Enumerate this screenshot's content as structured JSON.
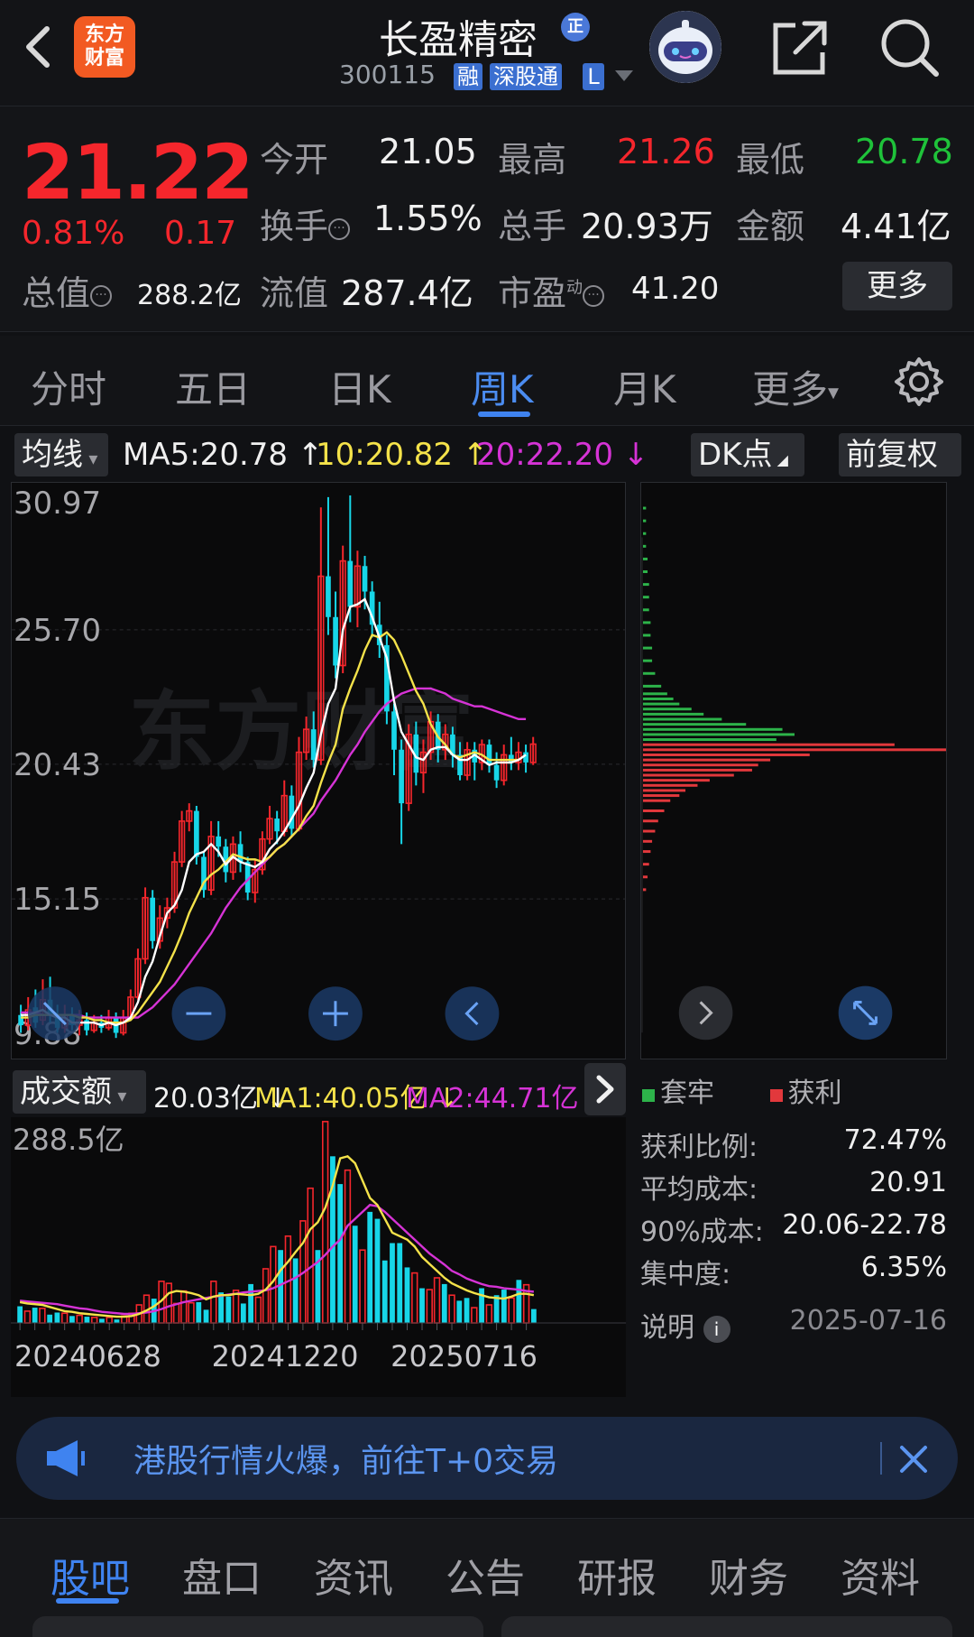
{
  "header": {
    "title": "长盈精密",
    "badge": "正",
    "logo_line1": "东方",
    "logo_line2": "财富",
    "code": "300115",
    "tags": [
      "融",
      "深股通",
      "L"
    ]
  },
  "quote": {
    "price": "21.22",
    "pct_change": "0.81%",
    "change": "0.17",
    "rows": [
      [
        {
          "label": "今开",
          "value": "21.05",
          "color": "white"
        },
        {
          "label": "最高",
          "value": "21.26",
          "color": "red"
        },
        {
          "label": "最低",
          "value": "20.78",
          "color": "green"
        }
      ],
      [
        {
          "label": "换手",
          "value": "1.55%",
          "color": "white"
        },
        {
          "label": "总手",
          "value": "20.93万",
          "color": "white"
        },
        {
          "label": "金额",
          "value": "4.41亿",
          "color": "white"
        }
      ],
      [
        {
          "label": "总值",
          "value": "288.2亿",
          "color": "white"
        },
        {
          "label": "流值",
          "value": "287.4亿",
          "color": "white"
        },
        {
          "label": "市盈",
          "label_sup": "动",
          "value": "41.20",
          "color": "white"
        }
      ]
    ],
    "more_label": "更多"
  },
  "tabs": [
    {
      "label": "分时",
      "active": false
    },
    {
      "label": "五日",
      "active": false
    },
    {
      "label": "日K",
      "active": false
    },
    {
      "label": "周K",
      "active": true
    },
    {
      "label": "月K",
      "active": false
    },
    {
      "label": "更多",
      "active": false
    }
  ],
  "ma_legend": {
    "selector": "均线",
    "ma5": "MA5:20.78 ↑",
    "ma10": "10:20.82 ↑",
    "ma20": "20:22.20 ↓",
    "dk": "DK点",
    "adjust": "前复权"
  },
  "volume_legend": {
    "selector": "成交额",
    "value": "20.03亿 ↓",
    "ma1": "MA1:40.05亿 ↓",
    "ma2": "MA2:44.71亿 ↓"
  },
  "chip_distribution": {
    "legend_trapped": "套牢",
    "legend_profit": "获利",
    "rows": [
      {
        "label": "获利比例:",
        "value": "72.47%"
      },
      {
        "label": "平均成本:",
        "value": "20.91"
      },
      {
        "label": "90%成本:",
        "value": "20.06-22.78"
      },
      {
        "label": "集中度:",
        "value": "6.35%"
      }
    ],
    "explain_label": "说明",
    "date": "2025-07-16"
  },
  "banner": {
    "text": "港股行情火爆，前往T+0交易"
  },
  "bottom_tabs": [
    {
      "label": "股吧",
      "active": true
    },
    {
      "label": "盘口",
      "active": false
    },
    {
      "label": "资讯",
      "active": false
    },
    {
      "label": "公告",
      "active": false
    },
    {
      "label": "研报",
      "active": false
    },
    {
      "label": "财务",
      "active": false
    },
    {
      "label": "资料",
      "active": false
    }
  ],
  "watermark": "东方财富",
  "chart_data": {
    "type": "candlestick",
    "title": "",
    "y_ticks": [
      "30.97",
      "25.70",
      "20.43",
      "15.15",
      "9.88"
    ],
    "ylim": [
      9.88,
      30.97
    ],
    "x_ticks": [
      "20240628",
      "20241220",
      "20250716"
    ],
    "volume_ylabel": "288.5亿",
    "candles": [
      {
        "o": 10.6,
        "c": 10.2,
        "h": 11.0,
        "l": 9.9
      },
      {
        "o": 10.2,
        "c": 10.8,
        "h": 11.3,
        "l": 10.0
      },
      {
        "o": 10.9,
        "c": 10.3,
        "h": 11.6,
        "l": 10.1
      },
      {
        "o": 10.4,
        "c": 11.2,
        "h": 12.0,
        "l": 10.2
      },
      {
        "o": 11.2,
        "c": 10.6,
        "h": 12.1,
        "l": 10.3
      },
      {
        "o": 10.6,
        "c": 10.1,
        "h": 11.0,
        "l": 9.9
      },
      {
        "o": 10.1,
        "c": 10.6,
        "h": 11.0,
        "l": 9.9
      },
      {
        "o": 10.6,
        "c": 10.2,
        "h": 10.9,
        "l": 10.0
      },
      {
        "o": 10.2,
        "c": 10.4,
        "h": 10.8,
        "l": 9.8
      },
      {
        "o": 10.4,
        "c": 10.0,
        "h": 10.7,
        "l": 9.8
      },
      {
        "o": 10.0,
        "c": 10.3,
        "h": 10.6,
        "l": 9.9
      },
      {
        "o": 10.3,
        "c": 10.1,
        "h": 10.6,
        "l": 9.9
      },
      {
        "o": 10.1,
        "c": 10.5,
        "h": 10.8,
        "l": 10.0
      },
      {
        "o": 10.5,
        "c": 9.9,
        "h": 10.7,
        "l": 9.7
      },
      {
        "o": 9.9,
        "c": 10.5,
        "h": 10.8,
        "l": 9.8
      },
      {
        "o": 10.5,
        "c": 11.3,
        "h": 11.6,
        "l": 10.4
      },
      {
        "o": 11.3,
        "c": 12.8,
        "h": 13.2,
        "l": 11.2
      },
      {
        "o": 12.8,
        "c": 15.2,
        "h": 15.6,
        "l": 12.6
      },
      {
        "o": 15.2,
        "c": 13.5,
        "h": 15.5,
        "l": 13.2
      },
      {
        "o": 13.5,
        "c": 14.4,
        "h": 14.9,
        "l": 13.2
      },
      {
        "o": 14.4,
        "c": 14.8,
        "h": 15.2,
        "l": 14.0
      },
      {
        "o": 14.8,
        "c": 16.6,
        "h": 17.0,
        "l": 14.6
      },
      {
        "o": 16.6,
        "c": 18.2,
        "h": 18.6,
        "l": 16.4
      },
      {
        "o": 18.2,
        "c": 18.6,
        "h": 18.9,
        "l": 17.8
      },
      {
        "o": 18.6,
        "c": 16.8,
        "h": 18.8,
        "l": 16.5
      },
      {
        "o": 16.8,
        "c": 15.5,
        "h": 17.0,
        "l": 15.2
      },
      {
        "o": 15.5,
        "c": 17.6,
        "h": 18.2,
        "l": 15.3
      },
      {
        "o": 17.6,
        "c": 17.2,
        "h": 18.2,
        "l": 16.8
      },
      {
        "o": 17.2,
        "c": 16.2,
        "h": 17.5,
        "l": 15.8
      },
      {
        "o": 16.2,
        "c": 17.3,
        "h": 17.6,
        "l": 15.9
      },
      {
        "o": 17.3,
        "c": 16.6,
        "h": 17.8,
        "l": 16.2
      },
      {
        "o": 16.6,
        "c": 15.4,
        "h": 16.8,
        "l": 15.1
      },
      {
        "o": 15.4,
        "c": 16.3,
        "h": 16.7,
        "l": 15.0
      },
      {
        "o": 16.3,
        "c": 17.5,
        "h": 17.8,
        "l": 16.1
      },
      {
        "o": 17.5,
        "c": 18.3,
        "h": 18.8,
        "l": 17.3
      },
      {
        "o": 18.3,
        "c": 17.8,
        "h": 18.6,
        "l": 17.3
      },
      {
        "o": 17.8,
        "c": 19.2,
        "h": 19.8,
        "l": 17.6
      },
      {
        "o": 19.2,
        "c": 17.9,
        "h": 19.6,
        "l": 17.6
      },
      {
        "o": 17.9,
        "c": 20.9,
        "h": 21.5,
        "l": 17.8
      },
      {
        "o": 20.9,
        "c": 21.8,
        "h": 22.3,
        "l": 20.6
      },
      {
        "o": 21.8,
        "c": 20.6,
        "h": 22.5,
        "l": 20.3
      },
      {
        "o": 20.6,
        "c": 27.8,
        "h": 30.5,
        "l": 20.4
      },
      {
        "o": 27.8,
        "c": 26.2,
        "h": 30.9,
        "l": 25.5
      },
      {
        "o": 26.2,
        "c": 24.3,
        "h": 27.2,
        "l": 23.8
      },
      {
        "o": 24.3,
        "c": 28.4,
        "h": 29.0,
        "l": 24.0
      },
      {
        "o": 28.4,
        "c": 26.6,
        "h": 30.97,
        "l": 26.0
      },
      {
        "o": 26.6,
        "c": 28.2,
        "h": 28.8,
        "l": 25.8
      },
      {
        "o": 28.2,
        "c": 27.2,
        "h": 28.6,
        "l": 26.5
      },
      {
        "o": 27.2,
        "c": 25.9,
        "h": 27.6,
        "l": 25.4
      },
      {
        "o": 25.9,
        "c": 25.1,
        "h": 26.8,
        "l": 24.6
      },
      {
        "o": 25.1,
        "c": 22.5,
        "h": 25.5,
        "l": 22.0
      },
      {
        "o": 22.5,
        "c": 21.0,
        "h": 22.8,
        "l": 20.0
      },
      {
        "o": 21.0,
        "c": 18.9,
        "h": 21.4,
        "l": 17.3
      },
      {
        "o": 18.9,
        "c": 21.6,
        "h": 22.0,
        "l": 18.6
      },
      {
        "o": 21.6,
        "c": 20.1,
        "h": 22.1,
        "l": 19.6
      },
      {
        "o": 20.1,
        "c": 20.9,
        "h": 21.4,
        "l": 19.3
      },
      {
        "o": 20.9,
        "c": 22.1,
        "h": 22.5,
        "l": 20.6
      },
      {
        "o": 22.1,
        "c": 21.0,
        "h": 22.4,
        "l": 20.5
      },
      {
        "o": 21.0,
        "c": 21.6,
        "h": 22.0,
        "l": 20.6
      },
      {
        "o": 21.6,
        "c": 20.8,
        "h": 21.9,
        "l": 20.3
      },
      {
        "o": 20.8,
        "c": 20.0,
        "h": 21.3,
        "l": 19.8
      },
      {
        "o": 20.0,
        "c": 21.0,
        "h": 21.3,
        "l": 19.8
      },
      {
        "o": 21.0,
        "c": 20.5,
        "h": 21.3,
        "l": 19.8
      },
      {
        "o": 20.5,
        "c": 21.2,
        "h": 21.4,
        "l": 20.2
      },
      {
        "o": 21.2,
        "c": 20.4,
        "h": 21.4,
        "l": 20.1
      },
      {
        "o": 20.4,
        "c": 19.8,
        "h": 20.9,
        "l": 19.5
      },
      {
        "o": 19.8,
        "c": 20.8,
        "h": 21.2,
        "l": 19.6
      },
      {
        "o": 20.8,
        "c": 20.5,
        "h": 21.5,
        "l": 20.2
      },
      {
        "o": 20.5,
        "c": 20.9,
        "h": 21.3,
        "l": 20.2
      },
      {
        "o": 20.9,
        "c": 20.5,
        "h": 21.2,
        "l": 20.1
      },
      {
        "o": 20.5,
        "c": 21.22,
        "h": 21.5,
        "l": 20.4
      }
    ],
    "ma5": [
      10.6,
      10.6,
      10.7,
      10.8,
      10.6,
      10.5,
      10.5,
      10.3,
      10.3,
      10.3,
      10.3,
      10.2,
      10.3,
      10.2,
      10.3,
      10.5,
      11.1,
      12.1,
      12.7,
      13.7,
      14.6,
      14.9,
      15.5,
      16.6,
      16.9,
      17.0,
      17.3,
      17.0,
      16.5,
      16.8,
      16.6,
      16.5,
      16.4,
      16.6,
      17.1,
      17.4,
      17.8,
      18.3,
      18.8,
      19.5,
      20.1,
      21.6,
      22.8,
      23.4,
      25.7,
      26.6,
      26.7,
      26.9,
      26.2,
      25.4,
      24.6,
      22.9,
      21.7,
      21.2,
      20.7,
      20.6,
      21.0,
      21.1,
      21.1,
      20.8,
      20.6,
      20.6,
      20.8,
      20.6,
      20.4,
      20.5,
      20.5,
      20.5,
      20.6,
      20.8
    ],
    "ma10": [
      10.5,
      10.5,
      10.6,
      10.6,
      10.6,
      10.6,
      10.6,
      10.6,
      10.5,
      10.5,
      10.4,
      10.4,
      10.3,
      10.3,
      10.3,
      10.4,
      10.7,
      11.1,
      11.5,
      11.9,
      12.5,
      13.1,
      13.8,
      14.6,
      15.2,
      15.8,
      16.1,
      16.3,
      16.6,
      16.9,
      16.8,
      16.7,
      16.7,
      16.6,
      16.8,
      17.1,
      17.3,
      17.6,
      17.9,
      18.4,
      18.8,
      19.7,
      20.5,
      21.2,
      22.6,
      23.4,
      24.1,
      24.9,
      25.5,
      25.4,
      25.6,
      25.3,
      24.7,
      24.0,
      23.3,
      22.8,
      22.0,
      21.5,
      21.2,
      20.8,
      20.7,
      20.8,
      20.9,
      20.8,
      20.6,
      20.6,
      20.6,
      20.6,
      20.6,
      20.8
    ],
    "ma20": [
      10.7,
      10.7,
      10.7,
      10.6,
      10.6,
      10.6,
      10.6,
      10.6,
      10.6,
      10.5,
      10.5,
      10.5,
      10.5,
      10.5,
      10.5,
      10.5,
      10.5,
      10.7,
      10.9,
      11.2,
      11.5,
      11.8,
      12.2,
      12.6,
      13.0,
      13.4,
      13.8,
      14.3,
      14.8,
      15.2,
      15.6,
      15.9,
      16.2,
      16.5,
      16.8,
      17.1,
      17.3,
      17.6,
      17.9,
      18.2,
      18.5,
      19.0,
      19.4,
      19.8,
      20.3,
      20.8,
      21.2,
      21.7,
      22.1,
      22.5,
      22.8,
      23.0,
      23.2,
      23.3,
      23.4,
      23.4,
      23.4,
      23.3,
      23.2,
      23.0,
      22.9,
      22.8,
      22.7,
      22.7,
      22.6,
      22.5,
      22.4,
      22.3,
      22.2,
      22.2
    ],
    "volume": [
      24,
      17,
      22,
      21,
      12,
      15,
      14,
      10,
      11,
      9,
      8,
      6,
      8,
      5,
      10,
      14,
      26,
      40,
      35,
      60,
      57,
      28,
      46,
      29,
      30,
      19,
      60,
      44,
      38,
      47,
      28,
      56,
      37,
      78,
      110,
      105,
      125,
      93,
      147,
      194,
      105,
      290,
      240,
      200,
      220,
      140,
      105,
      160,
      150,
      90,
      115,
      115,
      80,
      72,
      50,
      48,
      65,
      56,
      40,
      32,
      36,
      22,
      50,
      26,
      40,
      48,
      36,
      62,
      55,
      20
    ],
    "vol_ma1": [
      30,
      28,
      27,
      26,
      23,
      20,
      17,
      16,
      14,
      13,
      12,
      11,
      10,
      9,
      9,
      10,
      13,
      18,
      24,
      32,
      43,
      46,
      45,
      43,
      40,
      34,
      38,
      40,
      40,
      42,
      41,
      40,
      42,
      48,
      60,
      76,
      88,
      102,
      115,
      135,
      145,
      166,
      198,
      237,
      240,
      230,
      205,
      180,
      170,
      150,
      130,
      125,
      120,
      110,
      95,
      85,
      75,
      65,
      57,
      52,
      47,
      43,
      40,
      37,
      36,
      35,
      38,
      42,
      42,
      40
    ],
    "vol_ma2": [
      32,
      31,
      30,
      29,
      28,
      27,
      25,
      23,
      21,
      20,
      18,
      16,
      15,
      14,
      13,
      13,
      14,
      15,
      17,
      20,
      24,
      27,
      30,
      32,
      34,
      36,
      38,
      39,
      41,
      42,
      44,
      45,
      46,
      47,
      50,
      55,
      60,
      65,
      72,
      80,
      88,
      98,
      110,
      120,
      140,
      150,
      160,
      170,
      168,
      160,
      150,
      140,
      130,
      120,
      110,
      100,
      92,
      84,
      75,
      70,
      64,
      60,
      56,
      53,
      52,
      50,
      49,
      48,
      46,
      45
    ],
    "chip_rows": [
      {
        "price": 30.5,
        "profit": false,
        "w": 0.01
      },
      {
        "price": 30.0,
        "profit": false,
        "w": 0.01
      },
      {
        "price": 29.5,
        "profit": false,
        "w": 0.01
      },
      {
        "price": 29.0,
        "profit": false,
        "w": 0.01
      },
      {
        "price": 28.5,
        "profit": false,
        "w": 0.015
      },
      {
        "price": 28.0,
        "profit": false,
        "w": 0.015
      },
      {
        "price": 27.5,
        "profit": false,
        "w": 0.02
      },
      {
        "price": 27.0,
        "profit": false,
        "w": 0.02
      },
      {
        "price": 26.5,
        "profit": false,
        "w": 0.02
      },
      {
        "price": 26.0,
        "profit": false,
        "w": 0.025
      },
      {
        "price": 25.5,
        "profit": false,
        "w": 0.025
      },
      {
        "price": 25.0,
        "profit": false,
        "w": 0.03
      },
      {
        "price": 24.5,
        "profit": false,
        "w": 0.03
      },
      {
        "price": 24.0,
        "profit": false,
        "w": 0.04
      },
      {
        "price": 23.5,
        "profit": false,
        "w": 0.06
      },
      {
        "price": 23.2,
        "profit": false,
        "w": 0.08
      },
      {
        "price": 23.0,
        "profit": false,
        "w": 0.1
      },
      {
        "price": 22.8,
        "profit": false,
        "w": 0.12
      },
      {
        "price": 22.6,
        "profit": false,
        "w": 0.16
      },
      {
        "price": 22.4,
        "profit": false,
        "w": 0.2
      },
      {
        "price": 22.2,
        "profit": false,
        "w": 0.26
      },
      {
        "price": 22.0,
        "profit": false,
        "w": 0.34
      },
      {
        "price": 21.8,
        "profit": false,
        "w": 0.46
      },
      {
        "price": 21.6,
        "profit": false,
        "w": 0.5
      },
      {
        "price": 21.4,
        "profit": false,
        "w": 0.44
      },
      {
        "price": 21.2,
        "profit": true,
        "w": 0.83
      },
      {
        "price": 21.0,
        "profit": true,
        "w": 1.0
      },
      {
        "price": 20.8,
        "profit": true,
        "w": 0.55
      },
      {
        "price": 20.6,
        "profit": true,
        "w": 0.42
      },
      {
        "price": 20.4,
        "profit": true,
        "w": 0.38
      },
      {
        "price": 20.2,
        "profit": true,
        "w": 0.36
      },
      {
        "price": 20.0,
        "profit": true,
        "w": 0.3
      },
      {
        "price": 19.8,
        "profit": true,
        "w": 0.22
      },
      {
        "price": 19.6,
        "profit": true,
        "w": 0.18
      },
      {
        "price": 19.4,
        "profit": true,
        "w": 0.14
      },
      {
        "price": 19.2,
        "profit": true,
        "w": 0.12
      },
      {
        "price": 19.0,
        "profit": true,
        "w": 0.09
      },
      {
        "price": 18.6,
        "profit": true,
        "w": 0.07
      },
      {
        "price": 18.2,
        "profit": true,
        "w": 0.05
      },
      {
        "price": 17.8,
        "profit": true,
        "w": 0.04
      },
      {
        "price": 17.4,
        "profit": true,
        "w": 0.03
      },
      {
        "price": 17.0,
        "profit": true,
        "w": 0.025
      },
      {
        "price": 16.5,
        "profit": true,
        "w": 0.02
      },
      {
        "price": 16.0,
        "profit": true,
        "w": 0.015
      },
      {
        "price": 15.5,
        "profit": true,
        "w": 0.01
      }
    ]
  },
  "colors": {
    "up": "#f5262c",
    "down": "#17d6e8",
    "ma5": "#ffffff",
    "ma10": "#f4e24a",
    "ma20": "#d633d6",
    "accent": "#3f83f0",
    "chip_trapped": "#2db34a",
    "chip_profit": "#e2383c"
  }
}
